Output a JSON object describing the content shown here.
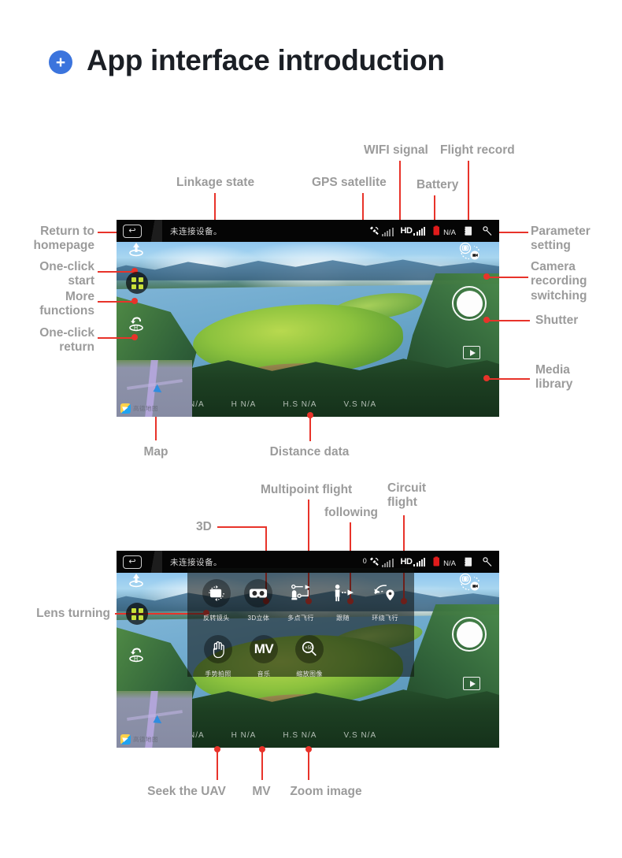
{
  "page": {
    "title": "App interface introduction",
    "bullet_icon": "plus-circle-icon",
    "accent_color": "#3b74dd",
    "annotation_color": "#9b9b9b",
    "leader_line_color": "#e8332a"
  },
  "screen1": {
    "statusbar": {
      "back_icon": "return-home-icon",
      "title": "未连接设备。",
      "satellite_count": "",
      "satellite_icon": "gps-satellite-icon",
      "hd_label": "HD",
      "battery_icon": "battery-icon",
      "battery_value": "N/A",
      "flight_record_icon": "flight-record-icon",
      "settings_icon": "wrench-settings-icon"
    },
    "left_controls": [
      {
        "name": "one-click-start",
        "icon": "takeoff-arrow-icon"
      },
      {
        "name": "more-functions",
        "icon": "grid-four-squares-icon"
      },
      {
        "name": "one-click-return",
        "icon": "return-home-drone-icon"
      }
    ],
    "right_controls": [
      {
        "name": "camera-recording-switch",
        "icon": "camera-video-switch-icon"
      },
      {
        "name": "shutter",
        "icon": "shutter-button-icon"
      },
      {
        "name": "media-library",
        "icon": "play-media-icon"
      }
    ],
    "telemetry": [
      {
        "key": "D",
        "value": "N/A"
      },
      {
        "key": "H",
        "value": "N/A"
      },
      {
        "key": "H.S",
        "value": "N/A"
      },
      {
        "key": "V.S",
        "value": "N/A"
      }
    ],
    "minimap": {
      "logo_text": "高德地图",
      "marker_icon": "drone-heading-arrow-icon"
    }
  },
  "screen2": {
    "statusbar": {
      "back_icon": "return-home-icon",
      "title": "未连接设备。",
      "satellite_count": "0",
      "satellite_icon": "gps-satellite-icon",
      "hd_label": "HD",
      "battery_icon": "battery-icon",
      "battery_value": "N/A",
      "flight_record_icon": "flight-record-icon",
      "settings_icon": "wrench-settings-icon"
    },
    "func_panel": {
      "row1": [
        {
          "label": "反转镜头",
          "icon": "lens-turning-icon"
        },
        {
          "label": "3D立体",
          "icon": "3d-vr-goggles-icon"
        },
        {
          "label": "多点飞行",
          "icon": "multipoint-flight-icon"
        },
        {
          "label": "跟随",
          "icon": "following-icon"
        },
        {
          "label": "环绕飞行",
          "icon": "circuit-flight-icon"
        }
      ],
      "row2": [
        {
          "label": "手势拍照",
          "icon": "gesture-hand-icon"
        },
        {
          "label": "音乐",
          "icon": "mv-music-icon",
          "text": "MV"
        },
        {
          "label": "缩放图像",
          "icon": "zoom-image-icon",
          "text": "×50"
        }
      ]
    },
    "telemetry": [
      {
        "key": "D",
        "value": "N/A"
      },
      {
        "key": "H",
        "value": "N/A"
      },
      {
        "key": "H.S",
        "value": "N/A"
      },
      {
        "key": "V.S",
        "value": "N/A"
      }
    ],
    "minimap": {
      "logo_text": "高德地图",
      "marker_icon": "drone-heading-arrow-icon"
    }
  },
  "annotations": {
    "s1": {
      "linkage_state": "Linkage state",
      "gps_satellite": "GPS satellite",
      "wifi_signal": "WIFI signal",
      "battery": "Battery",
      "flight_record": "Flight record",
      "return_to_homepage": "Return to\nhomepage",
      "one_click_start": "One-click\nstart",
      "more_functions": "More\nfunctions",
      "one_click_return": "One-click\nreturn",
      "parameter_setting": "Parameter\nsetting",
      "camera_recording_switching": "Camera\nrecording\nswitching",
      "shutter": "Shutter",
      "media_library": "Media\nlibrary",
      "map": "Map",
      "distance_data": "Distance data"
    },
    "s2": {
      "multipoint_flight": "Multipoint flight",
      "following": "following",
      "circuit_flight": "Circuit\nflight",
      "three_d": "3D",
      "lens_turning": "Lens turning",
      "seek_the_uav": "Seek the UAV",
      "mv": "MV",
      "zoom_image": "Zoom image"
    }
  }
}
